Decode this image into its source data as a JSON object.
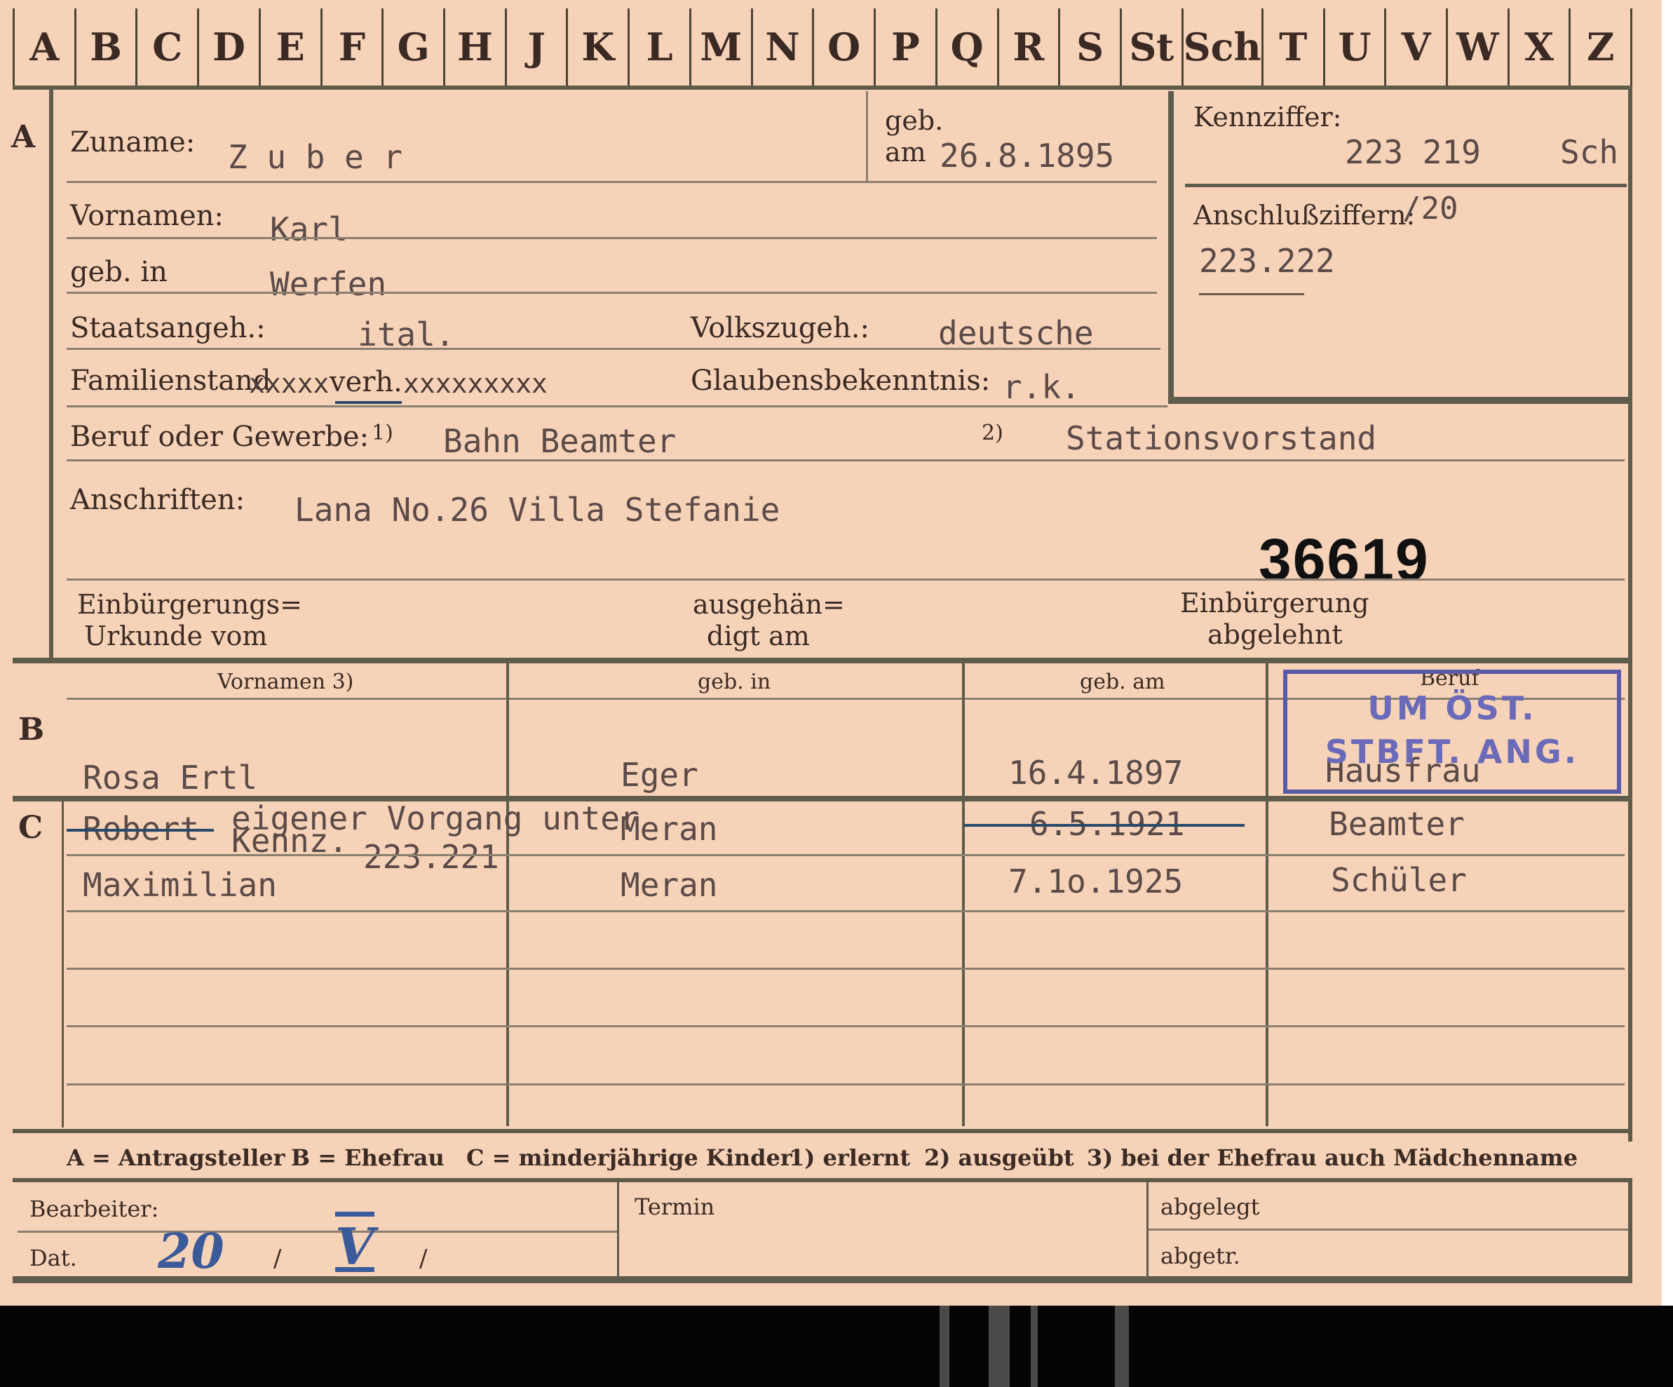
{
  "tabs": [
    "A",
    "B",
    "C",
    "D",
    "E",
    "F",
    "G",
    "H",
    "J",
    "K",
    "L",
    "M",
    "N",
    "O",
    "P",
    "Q",
    "R",
    "S",
    "St",
    "Sch",
    "T",
    "U",
    "V",
    "W",
    "X",
    "Z"
  ],
  "section_markers": {
    "a": "A",
    "b": "B",
    "c": "C"
  },
  "applicant": {
    "surname_label": "Zuname:",
    "surname": "Z u b e r",
    "born_label_top": "geb.",
    "born_label_am": "am",
    "born_date": "26.8.1895",
    "firstnames_label": "Vornamen:",
    "firstnames": "Karl",
    "birthplace_label": "geb. in",
    "birthplace": "Werfen",
    "citizenship_label": "Staatsangeh.:",
    "citizenship": "ital.",
    "ethnicity_label": "Volkszugeh.:",
    "ethnicity": "deutsche",
    "family_label": "Familienstand",
    "family_options": "verh.",
    "religion_label": "Glaubensbekenntnis:",
    "religion": "r.k.",
    "occupation_label": "Beruf oder Gewerbe:",
    "occ_note1": "1)",
    "occupation1": "Bahn Beamter",
    "occ_note2": "2)",
    "occupation2": "Stationsvorstand",
    "address_label": "Anschriften:",
    "address": "Lana No.26  Villa Stefanie",
    "file_number": "36619",
    "naturalization_label_1": "Einbürgerungs=",
    "naturalization_label_2": "Urkunde vom",
    "issued_label_1": "ausgehän=",
    "issued_label_2": "digt am",
    "refused_label_1": "Einbürgerung",
    "refused_label_2": "abgelehnt"
  },
  "reference": {
    "code_label": "Kennziffer:",
    "code": "223 219",
    "code_suffix": "Sch",
    "link_label": "Anschlußziffern:",
    "link_suffix": "/20",
    "link_value": "223.222"
  },
  "table": {
    "headers": {
      "firstnames": "Vornamen 3)",
      "birthplace": "geb. in",
      "birthdate": "geb. am",
      "occupation": "Beruf"
    },
    "spouse": {
      "firstnames": "Rosa  Ertl",
      "birthplace": "Eger",
      "birthdate": "16.4.1897",
      "occupation": "Hausfrau"
    },
    "children": [
      {
        "firstnames": "Robert",
        "birthplace": "Meran",
        "birthdate": "6.5.1921",
        "occupation": "Beamter"
      },
      {
        "firstnames": "Maximilian",
        "birthplace": "Meran",
        "birthdate": "7.1o.1925",
        "occupation": "Schüler"
      }
    ],
    "overlay_note_1": "eigener Vorgang unter",
    "overlay_note_2": "Kennz.",
    "overlay_note_3": "223.221"
  },
  "stamp": {
    "line1": "UM ÖST.",
    "line2": "STBFT. ANG."
  },
  "legend": {
    "a": "A = Antragsteller",
    "b": "B = Ehefrau",
    "c": "C = minderjährige Kinder",
    "n1": "1) erlernt",
    "n2": "2) ausgeübt",
    "n3": "3) bei der Ehefrau auch Mädchenname"
  },
  "footer": {
    "clerk_label": "Bearbeiter:",
    "date_label": "Dat.",
    "date_day": "20",
    "date_month": "V",
    "sep1": "/",
    "sep2": "/",
    "deadline_label": "Termin",
    "filed_label": "abgelegt",
    "delivered_label": "abgetr."
  },
  "colors": {
    "card": "#f6d2b8",
    "rule": "#5f5c4c",
    "stamp": "#5a5aa8",
    "ink": "#3a5a9a"
  }
}
